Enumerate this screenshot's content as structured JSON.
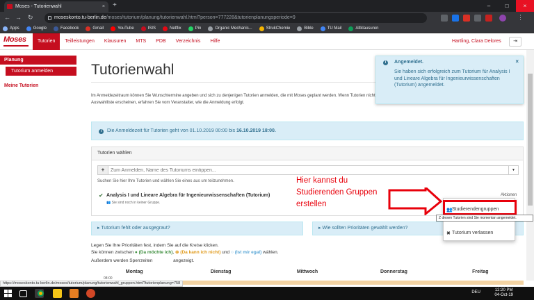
{
  "browser": {
    "tab_title": "Moses - Tutorienwahl",
    "url_host": "moseskonto.tu-berlin.de",
    "url_path": "/moses/tutorium/planung/tutorienwahl.html?person=777228&tutorienplanungsperiode=9",
    "bookmarks": [
      {
        "label": "Apps",
        "color": "#8ab4f8"
      },
      {
        "label": "Google",
        "color": "#4285f4"
      },
      {
        "label": "Facebook",
        "color": "#3b5998"
      },
      {
        "label": "Gmail",
        "color": "#d93025"
      },
      {
        "label": "YouTube",
        "color": "#ff0000"
      },
      {
        "label": "ISIS",
        "color": "#c50e1f"
      },
      {
        "label": "Netflix",
        "color": "#e50914"
      },
      {
        "label": "Pin",
        "color": "#25d366"
      },
      {
        "label": "Organic Mechanis...",
        "color": "#9aa0a6"
      },
      {
        "label": "StrukChemie",
        "color": "#f4b400"
      },
      {
        "label": "Bible",
        "color": "#9aa0a6"
      },
      {
        "label": "TU Mail",
        "color": "#4285f4"
      },
      {
        "label": "Altklausuren",
        "color": "#0f9d58"
      }
    ]
  },
  "header": {
    "logo": "Moses",
    "nav": [
      "Tutorien",
      "Teilleistungen",
      "Klausuren",
      "MTS",
      "PDB",
      "Verzeichnis",
      "Hilfe"
    ],
    "user": "Hartling, Clara Delores"
  },
  "sidebar": {
    "section": "Planung",
    "active_item": "Tutorium anmelden",
    "link": "Meine Tutorien"
  },
  "main": {
    "title": "Tutorienwahl",
    "intro": "Im Anmeldezeitraum können Sie Wunschtermine angeben und sich zu denjenigen Tutorien anmelden, die mit Moses geplant werden. Wenn Tutorien nicht in der Auswahlliste erscheinen, erfahren Sie vom Veranstalter, wie die Anmeldung erfolgt.",
    "info_prefix": "Die Anmeldezeit für Tutorien geht von 01.10.2019 00:00 bis ",
    "info_date": "16.10.2019 18:00.",
    "panel_title": "Tutorien wählen",
    "search_placeholder": "Zum Anmelden, Name des Tutoriums eintippen...",
    "search_help": "Suchen Sie hier Ihre Tutorien und wählen Sie eines aus um teilzunehmen.",
    "course_title": "Analysis I und Lineare Algebra für Ingenieurwissenschaften (Tutorium)",
    "course_note": "Sie sind noch in keiner Gruppe.",
    "aktionen": "Aktionen",
    "alert_missing": "Tutorium fehlt oder ausgegraut?",
    "alert_priorities": "Wie sollten Prioritäten gewählt werden?",
    "prio_line1": "Legen Sie Ihre Prioritäten fest, indem Sie auf die Kreise klicken.",
    "prio_line2a": "Sie können zwischen",
    "prio_green": "(Da möchte ich)",
    "prio_orange": "(Da kann ich nicht)",
    "prio_and": "und",
    "prio_blue": "(Ist mir egal)",
    "prio_line2b": "wählen.",
    "prio_line3a": "Außerdem werden Sperrzeiten",
    "prio_line3b": "angezeigt.",
    "days": [
      "Montag",
      "Dienstag",
      "Mittwoch",
      "Donnerstag",
      "Freitag"
    ],
    "time": "08:00"
  },
  "toast": {
    "title": "Angemeldet.",
    "message": "Sie haben sich erfolgreich zum Tutorium für Analysis I und Lineare Algebra für Ingenieurwissenschaften (Tutorium) angemeldet."
  },
  "dropdown": {
    "item1": "Studierendengruppen",
    "item2": "Tutorium verlassen",
    "tooltip": "Z diesen Tutorien sind Sie momentan angemeldet."
  },
  "annotation": {
    "line1": "Hier kannst du",
    "line2": "Studierenden Gruppen",
    "line3": "erstellen"
  },
  "status_url": "https://moseskonto.tu-berlin.de/moses/tutorium/planung/tutorienwahl_gruppen.html?tutorienplanung=758",
  "taskbar": {
    "lang": "DEU",
    "time": "12:20 PM",
    "date": "04-Oct-19"
  },
  "colors": {
    "brand": "#c50e1f",
    "info_bg": "#d9edf7",
    "annotation": "#e8000b"
  }
}
